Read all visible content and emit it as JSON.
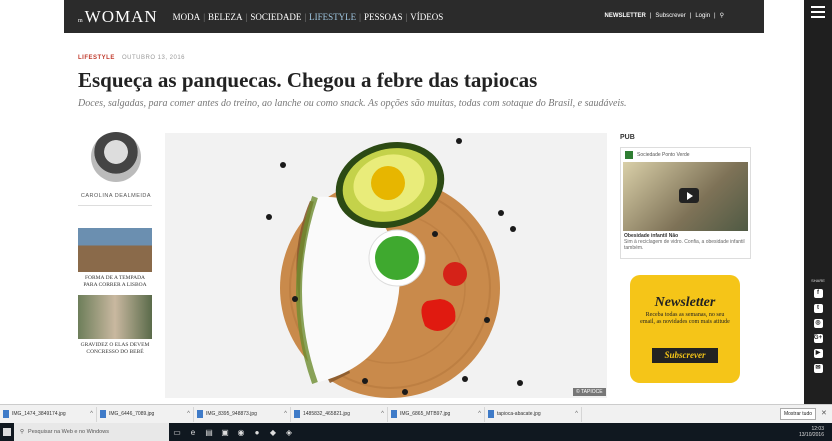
{
  "header": {
    "logo": "WOMAN",
    "logo_prefix": "m",
    "nav": [
      "MODA",
      "BELEZA",
      "SOCIEDADE",
      "LIFESTYLE",
      "PESSOAS",
      "VÍDEOS"
    ],
    "nav_active": "LIFESTYLE",
    "newsletter": "NEWSLETTER",
    "subscribe": "Subscrever",
    "login": "Login"
  },
  "article": {
    "category": "LIFESTYLE",
    "date": "OUTUBRO 13, 2016",
    "title": "Esqueça as panquecas. Chegou a febre das tapiocas",
    "subtitle": "Doces, salgadas, para comer antes do treino, ao lanche ou como snack. As opções são muitas, todas com sotaque do Brasil, e saudáveis.",
    "author": "CAROLINA DEALMEIDA",
    "image_credit": "© TAPIOCE"
  },
  "related": [
    {
      "title": "FORMA DE A TEMPADA PARA CORRER A LISBOA"
    },
    {
      "title": "GRAVIDEZ O ELAS DEVEM CONCRESSO DO BEBÉ"
    }
  ],
  "sidebar": {
    "pub_label": "PUB",
    "ad_brand": "Sociedade Ponto Verde",
    "ad_title": "Obesidade infantil Não",
    "ad_text": "Sim à reciclagem de vidro. Confia, a obesidade infantil também."
  },
  "newsletter": {
    "title": "Newsletter",
    "text": "Receba todas as semanas, no seu email, as novidades com mais atitude",
    "button": "Subscrever"
  },
  "share": {
    "label": "SHARE",
    "icons": [
      "f",
      "t",
      "◎",
      "G+",
      "▶",
      "✉"
    ]
  },
  "downloads": {
    "items": [
      "IMG_1474_3849174.jpg",
      "IMG_6446_7089.jpg",
      "IMG_8395_948873.jpg",
      "1485832_465821.jpg",
      "IMG_6865_MTB97.jpg",
      "tapioca-abacate.jpg"
    ],
    "show_all": "Mostrar tudo"
  },
  "taskbar": {
    "search_placeholder": "Pesquisar na Web e no Windows",
    "time": "12:03",
    "date": "13/10/2016"
  },
  "colors": {
    "accent": "#c0392b",
    "newsletter_bg": "#f5c518",
    "nav_bg": "#2b2b2b"
  }
}
